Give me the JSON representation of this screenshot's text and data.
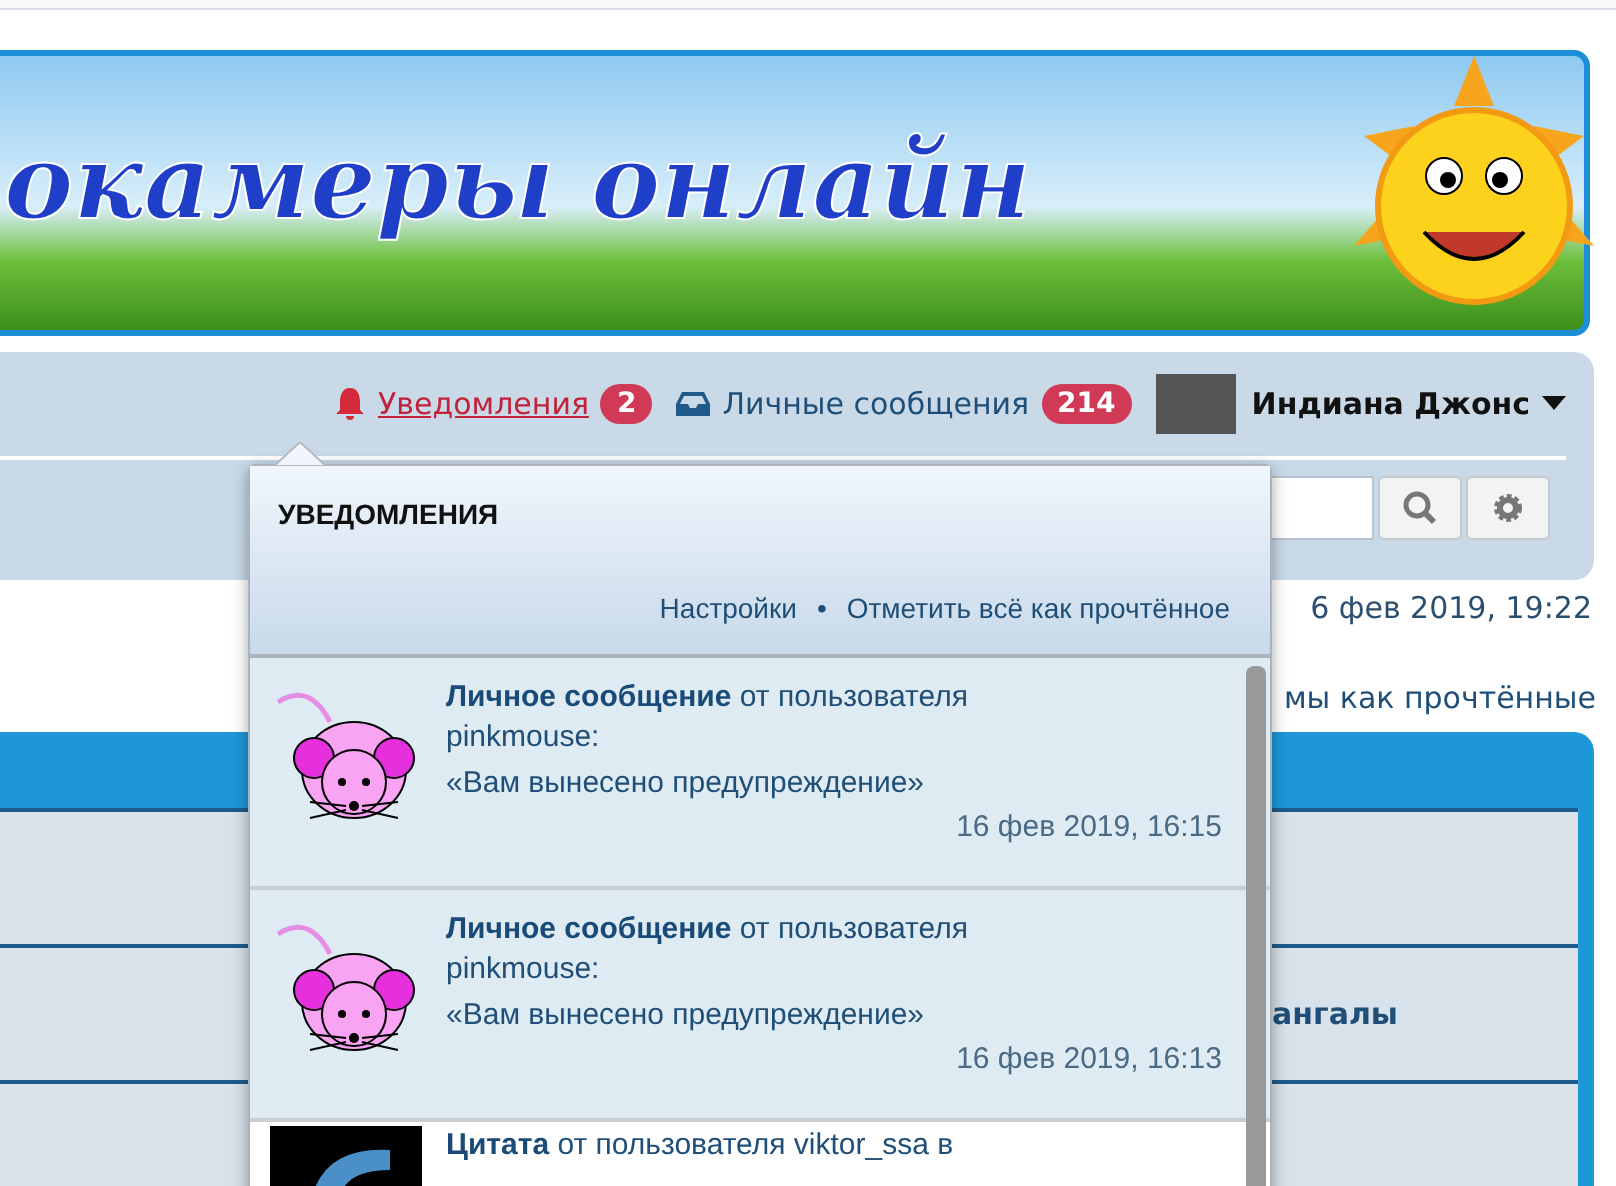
{
  "banner": {
    "title": "окамеры онлайн"
  },
  "navbar": {
    "notifications": {
      "label": "Уведомления",
      "count": "2",
      "selected": true
    },
    "messages": {
      "label": "Личные сообщения",
      "count": "214",
      "selected": false
    },
    "user": {
      "name": "Индиана Джонс"
    }
  },
  "page": {
    "date": "6 фев 2019, 19:22",
    "mark_read": "мы как прочтённые",
    "forum_title": "ангалы"
  },
  "popup": {
    "title": "УВЕДОМЛЕНИЯ",
    "links": [
      "Настройки",
      "Отметить всё как прочтённое"
    ],
    "separator": "•",
    "items": [
      {
        "kind": "message",
        "type_label": "Личное сообщение",
        "text": "от пользователя pinkmouse:",
        "quote": "«Вам вынесено предупреждение»",
        "time": "16 фев 2019, 16:15"
      },
      {
        "kind": "message",
        "type_label": "Личное сообщение",
        "text": "от пользователя pinkmouse:",
        "quote": "«Вам вынесено предупреждение»",
        "time": "16 фев 2019, 16:13"
      },
      {
        "kind": "quote",
        "type_label": "Цитата",
        "text": "от пользователя viktor_ssa в"
      }
    ]
  }
}
